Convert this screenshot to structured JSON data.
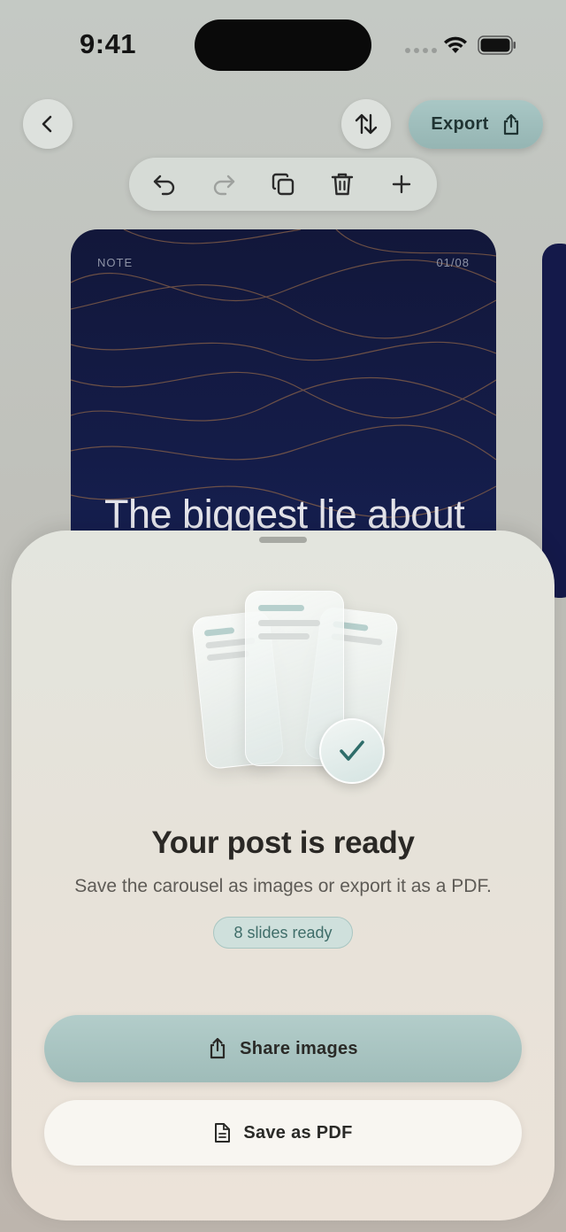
{
  "status_bar": {
    "time": "9:41"
  },
  "header": {
    "export_label": "Export"
  },
  "slide": {
    "tag": "NOTE",
    "counter": "01/08",
    "title": "The biggest lie about"
  },
  "sheet": {
    "title": "Your post is ready",
    "subtitle": "Save the carousel as images or export it as a PDF.",
    "badge": "8 slides ready",
    "share_label": "Share images",
    "pdf_label": "Save as PDF"
  },
  "icons": {
    "back": "chevron-left-icon",
    "sort": "swap-vertical-icon",
    "export": "share-icon",
    "undo": "undo-icon",
    "redo": "redo-icon",
    "duplicate": "duplicate-icon",
    "delete": "trash-icon",
    "add": "plus-icon",
    "check": "checkmark-icon",
    "document": "document-icon"
  },
  "colors": {
    "accent": "#9fbcb9",
    "slide_background": "#141c48",
    "badge_text": "#3f6d69",
    "check": "#2f6d6a"
  }
}
